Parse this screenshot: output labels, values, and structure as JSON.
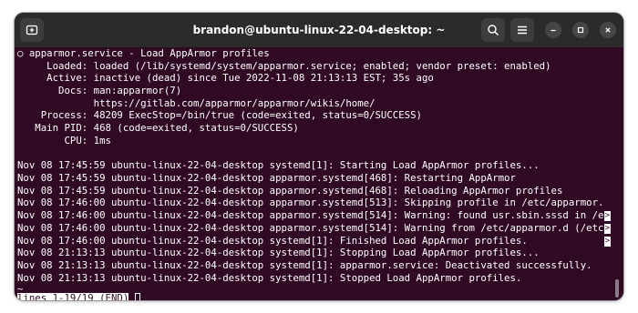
{
  "window": {
    "title": "brandon@ubuntu-linux-22-04-desktop: ~",
    "icons": {
      "new_tab": "new-tab-icon",
      "search": "search-icon",
      "menu": "hamburger-menu-icon",
      "minimize": "minimize-icon",
      "maximize": "maximize-icon",
      "close": "close-icon"
    }
  },
  "terminal": {
    "lines": [
      "○ apparmor.service - Load AppArmor profiles",
      "     Loaded: loaded (/lib/systemd/system/apparmor.service; enabled; vendor preset: enabled)",
      "     Active: inactive (dead) since Tue 2022-11-08 21:13:13 EST; 35s ago",
      "       Docs: man:apparmor(7)",
      "             https://gitlab.com/apparmor/apparmor/wikis/home/",
      "    Process: 48209 ExecStop=/bin/true (code=exited, status=0/SUCCESS)",
      "   Main PID: 468 (code=exited, status=0/SUCCESS)",
      "        CPU: 1ms",
      "",
      "Nov 08 17:45:59 ubuntu-linux-22-04-desktop systemd[1]: Starting Load AppArmor profiles...",
      "Nov 08 17:45:59 ubuntu-linux-22-04-desktop apparmor.systemd[468]: Restarting AppArmor",
      "Nov 08 17:45:59 ubuntu-linux-22-04-desktop apparmor.systemd[468]: Reloading AppArmor profiles",
      "Nov 08 17:46:00 ubuntu-linux-22-04-desktop apparmor.systemd[513]: Skipping profile in /etc/apparmor.",
      "Nov 08 17:46:00 ubuntu-linux-22-04-desktop apparmor.systemd[514]: Warning: found usr.sbin.sssd in /e",
      "Nov 08 17:46:00 ubuntu-linux-22-04-desktop apparmor.systemd[514]: Warning from /etc/apparmor.d (/etc",
      "Nov 08 17:46:00 ubuntu-linux-22-04-desktop systemd[1]: Finished Load AppArmor profiles.",
      "Nov 08 21:13:13 ubuntu-linux-22-04-desktop systemd[1]: Stopping Load AppArmor profiles...",
      "Nov 08 21:13:13 ubuntu-linux-22-04-desktop systemd[1]: apparmor.service: Deactivated successfully.",
      "Nov 08 21:13:13 ubuntu-linux-22-04-desktop systemd[1]: Stopped Load AppArmor profiles.",
      "~"
    ],
    "truncation_marker": ">",
    "pager_status": "lines 1-19/19 (END)"
  }
}
